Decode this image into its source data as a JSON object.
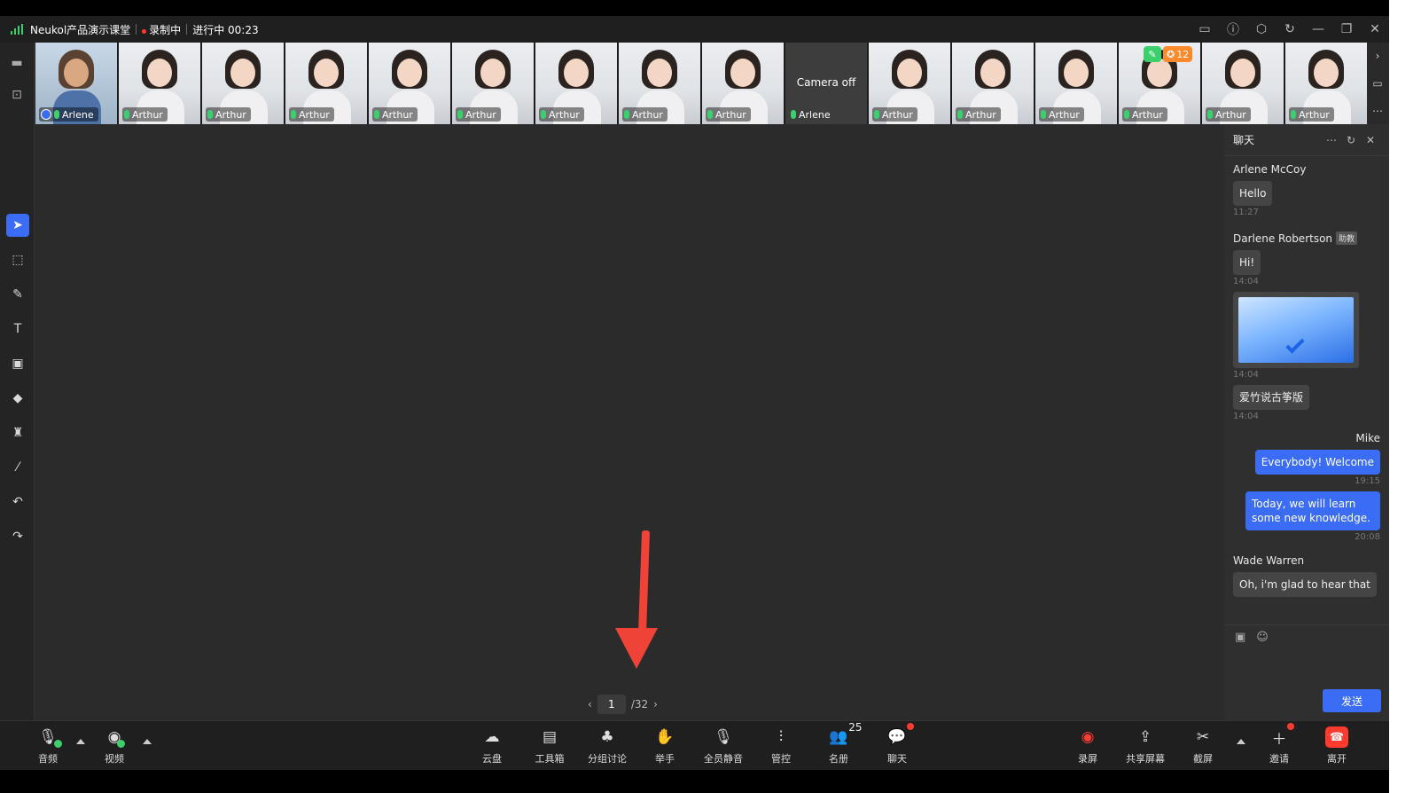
{
  "topbar": {
    "title": "Neukol产品演示课堂",
    "recording": "录制中",
    "status": "进行中 00:23",
    "icons": [
      "cast-icon",
      "help-icon",
      "settings-icon",
      "refresh-icon",
      "minimize-icon",
      "restore-icon",
      "close-icon"
    ]
  },
  "strip": {
    "first_name": "Arlene",
    "camera_off_text": "Camera off",
    "camera_off_name": "Arlene",
    "tile_name": "Arthur",
    "badge_count": "12"
  },
  "pager": {
    "current": "1",
    "total": "/32"
  },
  "chat": {
    "title": "聊天",
    "messages": {
      "m1_sender": "Arlene McCoy",
      "m1_text": "Hello",
      "m1_time": "11:27",
      "m2_sender": "Darlene Robertson",
      "m2_role": "助教",
      "m2_text": "Hi!",
      "m2_time": "14:04",
      "m3_time": "14:04",
      "m4_text": "爱竹说古筝版",
      "m4_time": "14:04",
      "m5_sender": "Mike",
      "m5_text": "Everybody! Welcome",
      "m5_time": "19:15",
      "m6_text": "Today, we will learn some new knowledge.",
      "m6_time": "20:08",
      "m7_sender": "Wade Warren",
      "m7_text": "Oh, i'm glad to hear that"
    },
    "send_label": "发送"
  },
  "bottombar": {
    "audio": "音频",
    "video": "视频",
    "cloud": "云盘",
    "toolbox": "工具箱",
    "breakout": "分组讨论",
    "raise_hand": "举手",
    "mute_all": "全员静音",
    "controls": "管控",
    "roster": "名册",
    "roster_count": "25",
    "chat": "聊天",
    "record": "录屏",
    "share": "共享屏幕",
    "screenshot": "截屏",
    "invite": "邀请",
    "leave": "离开"
  },
  "colors": {
    "accent": "#3b6cf6",
    "danger": "#ff3b30",
    "ok": "#3ccf6b"
  }
}
